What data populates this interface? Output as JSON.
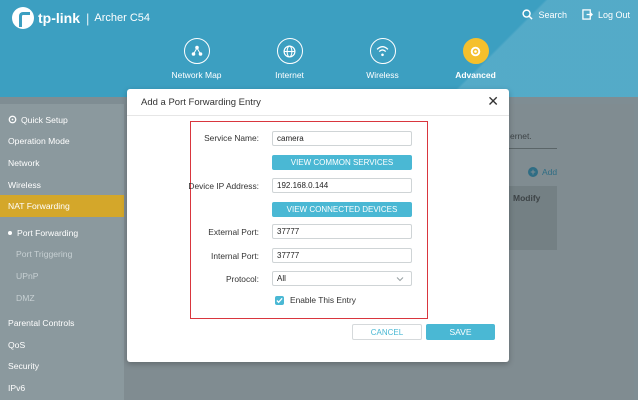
{
  "header": {
    "brand": "tp-link",
    "separator": "|",
    "model": "Archer C54",
    "search": "Search",
    "logout": "Log Out",
    "nav": [
      {
        "label": "Network Map",
        "icon": "network-map-icon"
      },
      {
        "label": "Internet",
        "icon": "globe-icon"
      },
      {
        "label": "Wireless",
        "icon": "wifi-icon"
      },
      {
        "label": "Advanced",
        "icon": "gear-icon",
        "active": true
      }
    ]
  },
  "sidebar": {
    "items": [
      {
        "label": "Quick Setup"
      },
      {
        "label": "Operation Mode"
      },
      {
        "label": "Network"
      },
      {
        "label": "Wireless"
      },
      {
        "label": "NAT Forwarding"
      },
      {
        "label": "Port Forwarding"
      },
      {
        "label": "Port Triggering"
      },
      {
        "label": "UPnP"
      },
      {
        "label": "DMZ"
      },
      {
        "label": "Parental Controls"
      },
      {
        "label": "QoS"
      },
      {
        "label": "Security"
      },
      {
        "label": "IPv6"
      }
    ]
  },
  "background": {
    "partial_text": "ernet.",
    "add_label": "Add",
    "modify_header": "Modify"
  },
  "modal": {
    "title": "Add a Port Forwarding Entry",
    "close": "✕",
    "service_name_label": "Service Name:",
    "service_name_value": "camera",
    "view_common_services": "VIEW COMMON SERVICES",
    "device_ip_label": "Device IP Address:",
    "device_ip_value": "192.168.0.144",
    "view_connected_devices": "VIEW CONNECTED DEVICES",
    "external_port_label": "External Port:",
    "external_port_value": "37777",
    "internal_port_label": "Internal Port:",
    "internal_port_value": "37777",
    "protocol_label": "Protocol:",
    "protocol_value": "All",
    "enable_entry_label": "Enable This Entry",
    "enable_entry_checked": true,
    "cancel": "CANCEL",
    "save": "SAVE"
  },
  "colors": {
    "header_bg": "#3c9fc1",
    "accent_blue": "#4ab8d4",
    "active_nav": "#f5c02c",
    "active_sidebar": "#d4a72a",
    "highlight_red": "#d9363e"
  }
}
